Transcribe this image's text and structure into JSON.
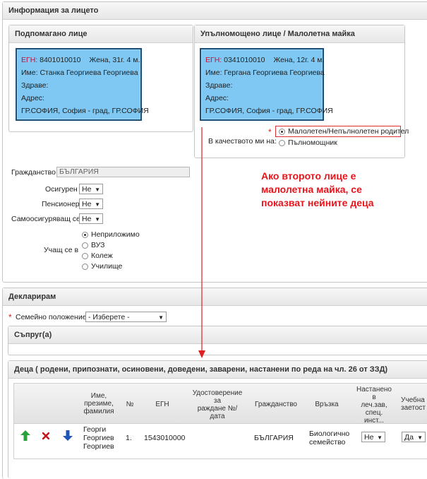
{
  "section_person": {
    "title": "Информация за лицето",
    "supported": {
      "title": "Подпомагано лице",
      "egn_label": "ЕГН:",
      "egn": "8401010010",
      "gender_age": "Жена, 31г. 4 м.",
      "name_label": "Име:",
      "name": "Станка Георгиева Георгиева",
      "health_label": "Здраве:",
      "address_label": "Адрес:",
      "address": "ГР.СОФИЯ, София - град, ГР.СОФИЯ"
    },
    "authorized": {
      "title": "Упълномощено лице / Малолетна майка",
      "egn_label": "ЕГН:",
      "egn": "0341010010",
      "gender_age": "Жена, 12г. 4 м.",
      "name_label": "Име:",
      "name": "Гергана Георгиева Георгиева",
      "health_label": "Здраве:",
      "address_label": "Адрес:",
      "address": "ГР.СОФИЯ, София - град, ГР.СОФИЯ",
      "capacity_label": "В качеството ми на:",
      "required_mark": "*",
      "options": [
        "Малолетен/Непълнолетен родител",
        "Пълномощник"
      ],
      "selected": 0
    },
    "citizenship_label": "Гражданство",
    "citizenship_value": "БЪЛГАРИЯ",
    "insured_label": "Осигурен",
    "insured_value": "Не",
    "pensioner_label": "Пенсионер",
    "pensioner_value": "Не",
    "selfinsured_label": "Самоосигуряващ се",
    "selfinsured_value": "Не",
    "studying_label": "Учащ се в",
    "studying_options": [
      "Неприложимо",
      "ВУЗ",
      "Колеж",
      "Училище"
    ],
    "studying_selected": 0
  },
  "annotation": {
    "lines": [
      "Ако второто лице е",
      "малолетна майка, се",
      "показват нейните деца"
    ]
  },
  "section_declare": {
    "title": "Декларирам",
    "required_mark": "*",
    "marital_label": "Семейно положение",
    "marital_value": "- Изберете -",
    "spouse_title": "Съпруг(а)",
    "children_title": "Деца ( родени, припознати, осиновени, доведени, заварени, настанени по реда на чл. 26 от ЗЗД)",
    "columns": {
      "name": [
        "Име,",
        "презиме,",
        "фамилия"
      ],
      "num": "№",
      "egn": "ЕГН",
      "birth_cert": [
        "Удостоверение",
        "за",
        "раждане №/",
        "дата"
      ],
      "citizenship": "Гражданство",
      "relation": "Връзка",
      "placed": [
        "Настанено",
        "в",
        "леч.зав,",
        "спец.",
        "инст..."
      ],
      "edu": [
        "Учебна",
        "заетост"
      ]
    },
    "rows": [
      {
        "name": [
          "Георги",
          "Георгиев",
          "Георгиев"
        ],
        "num": "1.",
        "egn": "1543010000",
        "citizenship": "БЪЛГАРИЯ",
        "relation": [
          "Биологично",
          "семейство"
        ],
        "placed": "Не",
        "edu": "Да"
      }
    ]
  },
  "colors": {
    "card_bg": "#7ec8f3",
    "card_border": "#1d4f79",
    "label_red": "#c1123b",
    "annotation_red": "#e8141b",
    "highlight_border": "#e03030",
    "arrow_red": "#e02020",
    "icon_up": "#2aa13c",
    "icon_delete": "#c4141c",
    "icon_down": "#1f56b8"
  },
  "icons": {
    "dropdown": "chevron-down-icon",
    "move_up": "arrow-up-icon",
    "remove": "close-icon",
    "move_down": "arrow-down-icon"
  }
}
